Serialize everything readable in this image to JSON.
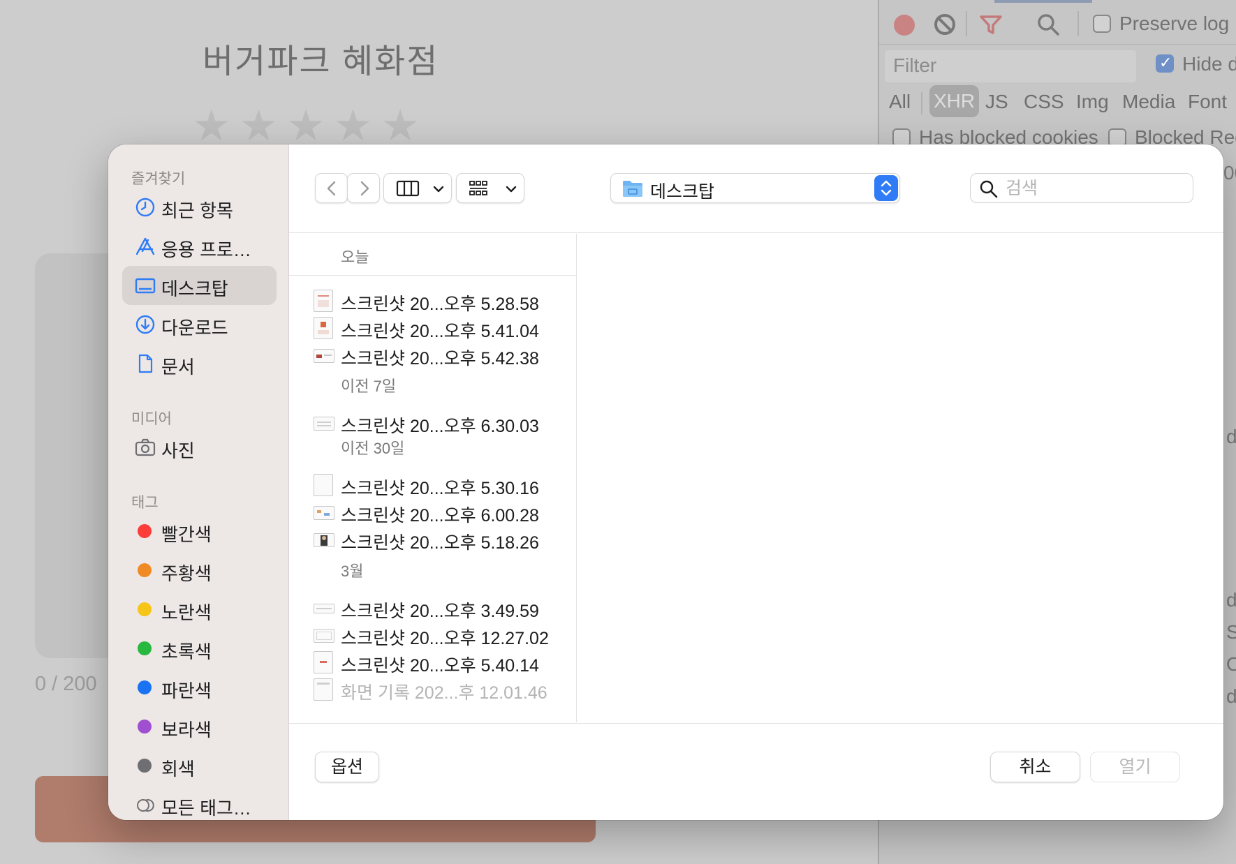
{
  "background": {
    "title": "버거파크 혜화점",
    "stars": [
      "★",
      "★",
      "★",
      "★",
      "★"
    ],
    "counter": "0 / 200"
  },
  "devtools": {
    "preserve_log": "Preserve log",
    "filter_placeholder": "Filter",
    "hide_label": "Hide d",
    "types": [
      "All",
      "XHR",
      "JS",
      "CSS",
      "Img",
      "Media",
      "Font"
    ],
    "active_type": "XHR",
    "has_blocked_cookies": "Has blocked cookies",
    "blocked_requests": "Blocked Req",
    "edge_fragments": [
      "00",
      "d",
      "d",
      "S",
      "O",
      "d"
    ]
  },
  "dialog": {
    "sidebar": {
      "favorites_title": "즐겨찾기",
      "favorites": [
        {
          "label": "최근 항목",
          "icon": "clock-icon"
        },
        {
          "label": "응용 프로…",
          "icon": "app-store-icon"
        },
        {
          "label": "데스크탑",
          "icon": "desktop-icon",
          "selected": true
        },
        {
          "label": "다운로드",
          "icon": "download-icon"
        },
        {
          "label": "문서",
          "icon": "document-icon"
        }
      ],
      "media_title": "미디어",
      "media": [
        {
          "label": "사진",
          "icon": "camera-icon"
        }
      ],
      "tags_title": "태그",
      "tags": [
        {
          "label": "빨간색",
          "color": "#fc3d39"
        },
        {
          "label": "주황색",
          "color": "#f08a24"
        },
        {
          "label": "노란색",
          "color": "#f5c518"
        },
        {
          "label": "초록색",
          "color": "#27b83f"
        },
        {
          "label": "파란색",
          "color": "#1a73f2"
        },
        {
          "label": "보라색",
          "color": "#a04fd0"
        },
        {
          "label": "회색",
          "color": "#6e6e73"
        }
      ],
      "all_tags": "모든 태그…"
    },
    "toolbar": {
      "path_label": "데스크탑",
      "search_placeholder": "검색"
    },
    "column_header": "오늘",
    "groups": [
      {
        "label": "오늘",
        "files": [
          "스크린샷 20...오후 5.28.58",
          "스크린샷 20...오후 5.41.04",
          "스크린샷 20...오후 5.42.38"
        ]
      },
      {
        "label": "이전 7일",
        "files": [
          "스크린샷 20...오후 6.30.03"
        ]
      },
      {
        "label": "이전 30일",
        "files": [
          "스크린샷 20...오후 5.30.16",
          "스크린샷 20...오후 6.00.28",
          "스크린샷 20...오후 5.18.26"
        ]
      },
      {
        "label": "3월",
        "files": [
          "스크린샷 20...오후 3.49.59",
          "스크린샷 20...오후 12.27.02",
          "스크린샷 20...오후 5.40.14",
          "화면 기록 202...후 12.01.46"
        ]
      }
    ],
    "footer": {
      "options": "옵션",
      "cancel": "취소",
      "open": "열기"
    }
  }
}
